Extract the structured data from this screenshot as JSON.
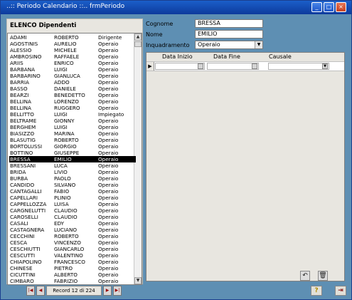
{
  "window": {
    "title": "..:: Periodo Calendario ::..  frmPeriodo",
    "minimize": "_",
    "maximize": "□",
    "close": "×"
  },
  "list": {
    "title": "ELENCO Dipendenti",
    "rows": [
      [
        "ADAMI",
        "ROBERTO",
        "Dirigente"
      ],
      [
        "AGOSTINIS",
        "AURELIO",
        "Operaio"
      ],
      [
        "ALESSIO",
        "MICHELE",
        "Operaio"
      ],
      [
        "AMBROSINO",
        "RAFFAELE",
        "Operaio"
      ],
      [
        "ARIIS",
        "ENRICO",
        "Operaio"
      ],
      [
        "BARBANA",
        "LUIGI",
        "Operaio"
      ],
      [
        "BARBARINO",
        "GIANLUCA",
        "Operaio"
      ],
      [
        "BARRIA",
        "ADDO",
        "Operaio"
      ],
      [
        "BASSO",
        "DANIELE",
        "Operaio"
      ],
      [
        "BEARZI",
        "BENEDETTO",
        "Operaio"
      ],
      [
        "BELLINA",
        "LORENZO",
        "Operaio"
      ],
      [
        "BELLINA",
        "RUGGERO",
        "Operaio"
      ],
      [
        "BELLITTO",
        "LUIGI",
        "Impiegato"
      ],
      [
        "BELTRAME",
        "GIONNY",
        "Operaio"
      ],
      [
        "BERGHEM",
        "LUIGI",
        "Operaio"
      ],
      [
        "BIASIZZO",
        "MARINA",
        "Operaio"
      ],
      [
        "BLASUTIG",
        "ROBERTO",
        "Operaio"
      ],
      [
        "BORTOLUSSI",
        "GIORGIO",
        "Operaio"
      ],
      [
        "BOTTINO",
        "GIUSEPPE",
        "Operaio"
      ],
      [
        "BRESSA",
        "EMILIO",
        "Operaio"
      ],
      [
        "BRESSANI",
        "LUCA",
        "Operaio"
      ],
      [
        "BRIDA",
        "LIVIO",
        "Operaio"
      ],
      [
        "BURBA",
        "PAOLO",
        "Operaio"
      ],
      [
        "CANDIDO",
        "SILVANO",
        "Operaio"
      ],
      [
        "CANTAGALLI",
        "FABIO",
        "Operaio"
      ],
      [
        "CAPELLARI",
        "PLINIO",
        "Operaio"
      ],
      [
        "CAPPELLOZZA",
        "LUISA",
        "Operaio"
      ],
      [
        "CARGNELUTTI",
        "CLAUDIO",
        "Operaio"
      ],
      [
        "CAROSELLI",
        "CLAUDIO",
        "Operaio"
      ],
      [
        "CASALI",
        "EDY",
        "Operaio"
      ],
      [
        "CASTAGNERA",
        "LUCIANO",
        "Operaio"
      ],
      [
        "CECCHINI",
        "ROBERTO",
        "Operaio"
      ],
      [
        "CESCA",
        "VINCENZO",
        "Operaio"
      ],
      [
        "CESCHIUTTI",
        "GIANCARLO",
        "Operaio"
      ],
      [
        "CESCUTTI",
        "VALENTINO",
        "Operaio"
      ],
      [
        "CHIAPOLINO",
        "FRANCESCO",
        "Operaio"
      ],
      [
        "CHINESE",
        "PIETRO",
        "Operaio"
      ],
      [
        "CICUTTINI",
        "ALBERTO",
        "Operaio"
      ],
      [
        "CIMBARO",
        "FABRIZIO",
        "Operaio"
      ]
    ],
    "selected_index": 19
  },
  "form": {
    "cognome_label": "Cognome",
    "cognome_value": "BRESSA",
    "nome_label": "Nome",
    "nome_value": "EMILIO",
    "inquadramento_label": "Inquadramento",
    "inquadramento_value": "Operaio"
  },
  "grid": {
    "headers": [
      "Data Inizio",
      "Data Fine",
      "Causale"
    ]
  },
  "nav": {
    "record_text": "Record 12 di 224"
  },
  "colors": {
    "window_bg": "#5e8fb3",
    "titlebar": "#1b5fc9",
    "selected_row": "#000000"
  }
}
